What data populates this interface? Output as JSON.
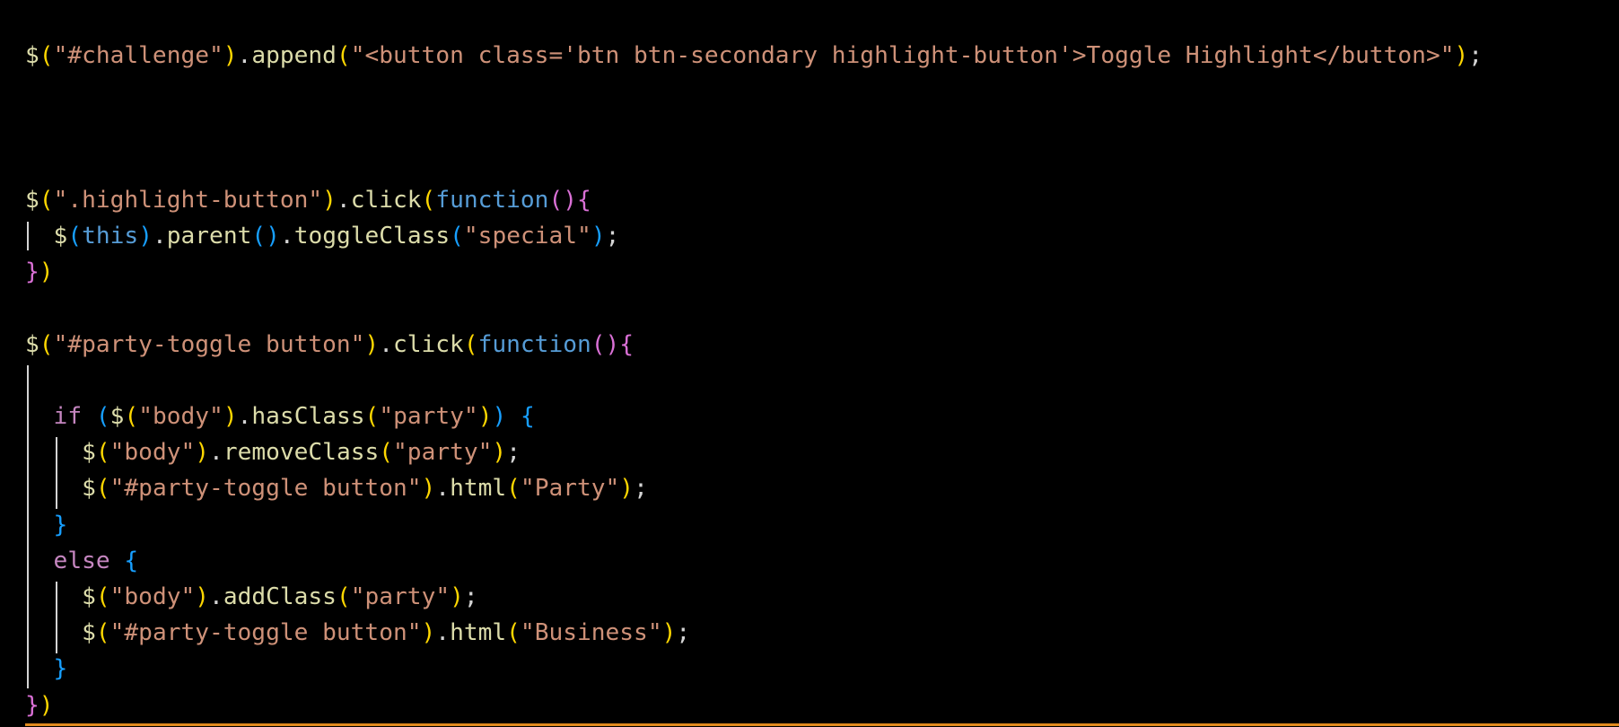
{
  "editor": {
    "background": "#000000",
    "token_colors": {
      "identifier": "#dcdcaa",
      "string": "#ce9178",
      "keyword": "#c586c0",
      "this": "#569cd6",
      "function_keyword": "#569cd6",
      "bracket_level1": "#ffd700",
      "bracket_level2": "#da70d6",
      "bracket_level3": "#179fff",
      "punctuation": "#d4d4d4"
    },
    "lines": [
      [
        [
          "$",
          "dollar"
        ],
        [
          "(",
          "b1"
        ],
        [
          "\"#challenge\"",
          "str"
        ],
        [
          ")",
          "b1"
        ],
        [
          ".",
          "punc"
        ],
        [
          "append",
          "fn"
        ],
        [
          "(",
          "b1"
        ],
        [
          "\"<button class='btn btn-secondary highlight-button'>Toggle Highlight</button>\"",
          "str"
        ],
        [
          ")",
          "b1"
        ],
        [
          ";",
          "punc"
        ]
      ],
      [],
      [],
      [],
      [
        [
          "$",
          "dollar"
        ],
        [
          "(",
          "b1"
        ],
        [
          "\".highlight-button\"",
          "str"
        ],
        [
          ")",
          "b1"
        ],
        [
          ".",
          "punc"
        ],
        [
          "click",
          "fn"
        ],
        [
          "(",
          "b1"
        ],
        [
          "function",
          "func"
        ],
        [
          "()",
          "b2"
        ],
        [
          "{",
          "b2"
        ]
      ],
      [
        [
          "  ",
          "punc"
        ],
        [
          "$",
          "dollar"
        ],
        [
          "(",
          "b3"
        ],
        [
          "this",
          "this"
        ],
        [
          ")",
          "b3"
        ],
        [
          ".",
          "punc"
        ],
        [
          "parent",
          "fn"
        ],
        [
          "()",
          "b3"
        ],
        [
          ".",
          "punc"
        ],
        [
          "toggleClass",
          "fn"
        ],
        [
          "(",
          "b3"
        ],
        [
          "\"special\"",
          "str"
        ],
        [
          ")",
          "b3"
        ],
        [
          ";",
          "punc"
        ]
      ],
      [
        [
          "}",
          "b2"
        ],
        [
          ")",
          "b1"
        ]
      ],
      [],
      [
        [
          "$",
          "dollar"
        ],
        [
          "(",
          "b1"
        ],
        [
          "\"#party-toggle button\"",
          "str"
        ],
        [
          ")",
          "b1"
        ],
        [
          ".",
          "punc"
        ],
        [
          "click",
          "fn"
        ],
        [
          "(",
          "b1"
        ],
        [
          "function",
          "func"
        ],
        [
          "()",
          "b2"
        ],
        [
          "{",
          "b2"
        ]
      ],
      [],
      [
        [
          "  ",
          "punc"
        ],
        [
          "if",
          "kw"
        ],
        [
          " ",
          "punc"
        ],
        [
          "(",
          "b3"
        ],
        [
          "$",
          "dollar"
        ],
        [
          "(",
          "b1"
        ],
        [
          "\"body\"",
          "str"
        ],
        [
          ")",
          "b1"
        ],
        [
          ".",
          "punc"
        ],
        [
          "hasClass",
          "fn"
        ],
        [
          "(",
          "b1"
        ],
        [
          "\"party\"",
          "str"
        ],
        [
          ")",
          "b1"
        ],
        [
          ")",
          "b3"
        ],
        [
          " ",
          "punc"
        ],
        [
          "{",
          "b3"
        ]
      ],
      [
        [
          "    ",
          "punc"
        ],
        [
          "$",
          "dollar"
        ],
        [
          "(",
          "b1"
        ],
        [
          "\"body\"",
          "str"
        ],
        [
          ")",
          "b1"
        ],
        [
          ".",
          "punc"
        ],
        [
          "removeClass",
          "fn"
        ],
        [
          "(",
          "b1"
        ],
        [
          "\"party\"",
          "str"
        ],
        [
          ")",
          "b1"
        ],
        [
          ";",
          "punc"
        ]
      ],
      [
        [
          "    ",
          "punc"
        ],
        [
          "$",
          "dollar"
        ],
        [
          "(",
          "b1"
        ],
        [
          "\"#party-toggle button\"",
          "str"
        ],
        [
          ")",
          "b1"
        ],
        [
          ".",
          "punc"
        ],
        [
          "html",
          "fn"
        ],
        [
          "(",
          "b1"
        ],
        [
          "\"Party\"",
          "str"
        ],
        [
          ")",
          "b1"
        ],
        [
          ";",
          "punc"
        ]
      ],
      [
        [
          "  ",
          "punc"
        ],
        [
          "}",
          "b3"
        ]
      ],
      [
        [
          "  ",
          "punc"
        ],
        [
          "else",
          "kw"
        ],
        [
          " ",
          "punc"
        ],
        [
          "{",
          "b3"
        ]
      ],
      [
        [
          "    ",
          "punc"
        ],
        [
          "$",
          "dollar"
        ],
        [
          "(",
          "b1"
        ],
        [
          "\"body\"",
          "str"
        ],
        [
          ")",
          "b1"
        ],
        [
          ".",
          "punc"
        ],
        [
          "addClass",
          "fn"
        ],
        [
          "(",
          "b1"
        ],
        [
          "\"party\"",
          "str"
        ],
        [
          ")",
          "b1"
        ],
        [
          ";",
          "punc"
        ]
      ],
      [
        [
          "    ",
          "punc"
        ],
        [
          "$",
          "dollar"
        ],
        [
          "(",
          "b1"
        ],
        [
          "\"#party-toggle button\"",
          "str"
        ],
        [
          ")",
          "b1"
        ],
        [
          ".",
          "punc"
        ],
        [
          "html",
          "fn"
        ],
        [
          "(",
          "b1"
        ],
        [
          "\"Business\"",
          "str"
        ],
        [
          ")",
          "b1"
        ],
        [
          ";",
          "punc"
        ]
      ],
      [
        [
          "  ",
          "punc"
        ],
        [
          "}",
          "b3"
        ]
      ],
      [
        [
          "}",
          "b2"
        ],
        [
          ")",
          "b1"
        ]
      ]
    ]
  }
}
